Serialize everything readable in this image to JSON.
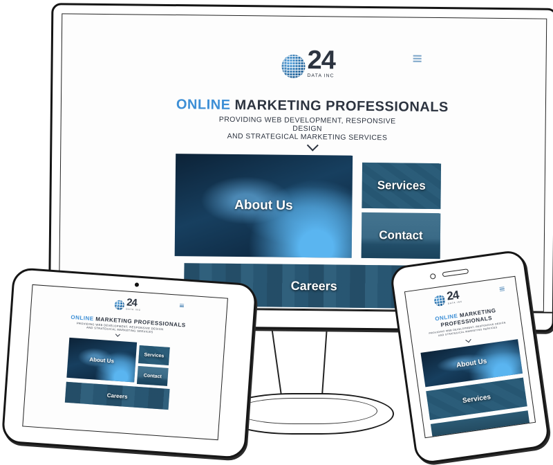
{
  "logo": {
    "number": "24",
    "subtitle": "DATA INC"
  },
  "hero": {
    "headline_accent": "ONLINE",
    "headline_rest": "MARKETING PROFESSIONALS",
    "subline_1": "PROVIDING WEB DEVELOPMENT, RESPONSIVE DESIGN",
    "subline_2": "AND STRATEGICAL MARKETING SERVICES"
  },
  "tiles": {
    "about": "About Us",
    "services": "Services",
    "contact": "Contact",
    "careers": "Careers"
  },
  "colors": {
    "accent": "#3d8fd6",
    "text": "#2d3440",
    "tile_overlay": "#1f5674"
  },
  "icons": {
    "menu": "hamburger-menu-icon",
    "scroll": "chevron-down-icon",
    "logo": "globe-logo-icon"
  }
}
